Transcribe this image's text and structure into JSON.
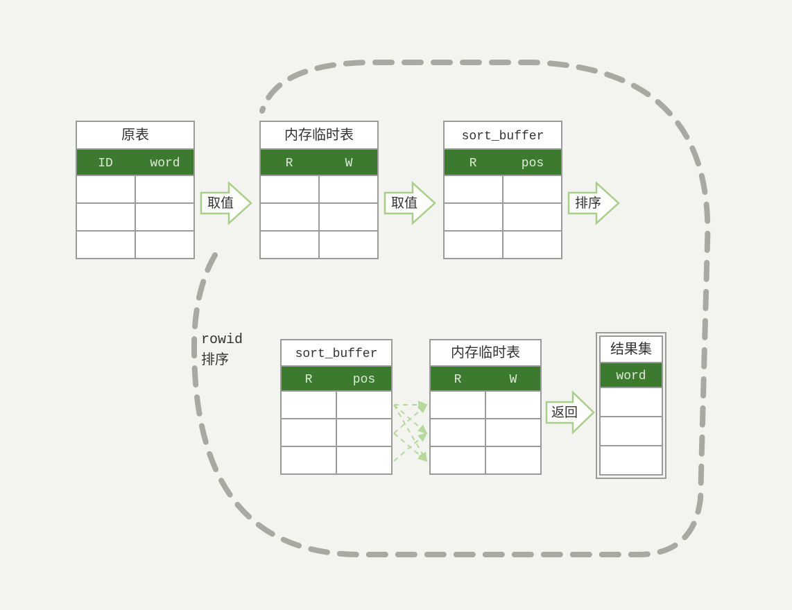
{
  "tables": {
    "orig": {
      "title": "原表",
      "cols": [
        "ID",
        "word"
      ]
    },
    "mem1": {
      "title": "内存临时表",
      "cols": [
        "R",
        "W"
      ]
    },
    "sbuf1": {
      "title": "sort_buffer",
      "cols": [
        "R",
        "pos"
      ]
    },
    "sbuf2": {
      "title": "sort_buffer",
      "cols": [
        "R",
        "pos"
      ]
    },
    "mem2": {
      "title": "内存临时表",
      "cols": [
        "R",
        "W"
      ]
    },
    "result": {
      "title": "结果集",
      "cols": [
        "word"
      ]
    }
  },
  "arrows": {
    "a1": "取值",
    "a2": "取值",
    "a3": "排序",
    "a4": "返回"
  },
  "side": {
    "l1": "rowid",
    "l2": "排序"
  },
  "colors": {
    "header": "#3b7a2f",
    "border": "#9a9a9a",
    "arrowStroke": "#a7cf8a",
    "arrowFill": "#fdfdfb",
    "dashStroke": "#a9a9a4",
    "crossArrow": "#b6d89a"
  }
}
